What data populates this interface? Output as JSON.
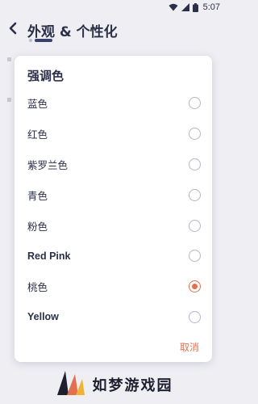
{
  "status_bar": {
    "time": "5:07"
  },
  "header": {
    "title": "外观 & 个性化"
  },
  "dialog": {
    "title": "强调色",
    "options": [
      {
        "label": "蓝色",
        "checked": false
      },
      {
        "label": "红色",
        "checked": false
      },
      {
        "label": "紫罗兰色",
        "checked": false
      },
      {
        "label": "青色",
        "checked": false
      },
      {
        "label": "粉色",
        "checked": false
      },
      {
        "label": "Red Pink",
        "checked": false
      },
      {
        "label": "桃色",
        "checked": true
      },
      {
        "label": "Yellow",
        "checked": false
      }
    ],
    "cancel_label": "取消"
  },
  "colors": {
    "accent": "#e2704f",
    "text": "#2c2f48",
    "background": "#eeeef3"
  },
  "watermark": {
    "brand": "如梦游戏园"
  }
}
